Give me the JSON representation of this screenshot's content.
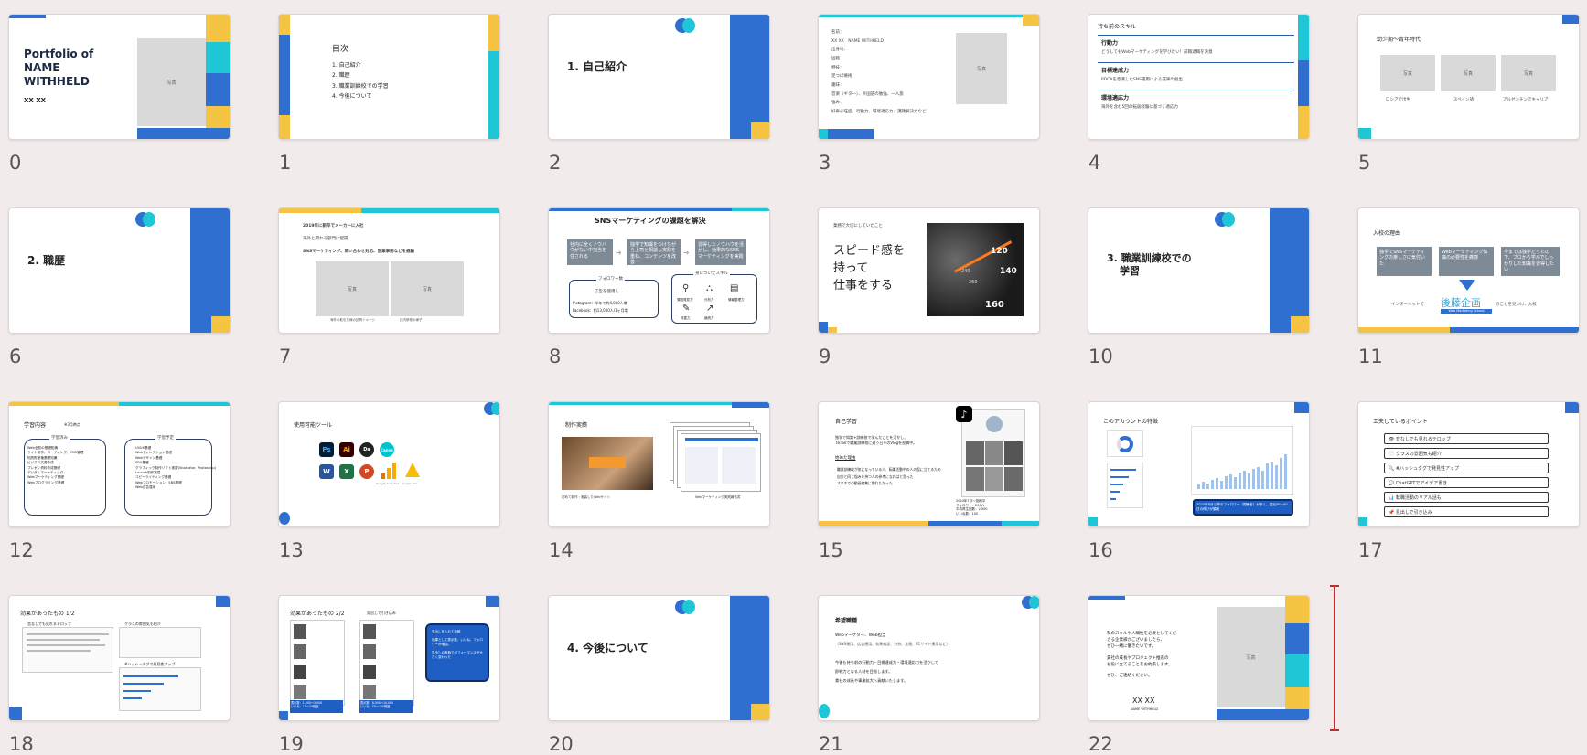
{
  "slides": [
    {
      "n": "0",
      "title": [
        "Portfolio of",
        "NAME",
        "WITHHELD"
      ],
      "sub": "XX XX",
      "photo": "写真"
    },
    {
      "n": "1",
      "title": "目次",
      "items": [
        "1. 自己紹介",
        "2. 職歴",
        "3. 職業訓練校での学習",
        "4. 今後について"
      ]
    },
    {
      "n": "2",
      "title": "1. 自己紹介"
    },
    {
      "n": "3",
      "rows": [
        "名前：",
        "XX XX　NAME WITHHELD",
        "出身地：",
        "国籍",
        "特技：",
        "足つぼ療術",
        "趣味：",
        "音楽（ギター）、外国語の勉強、一人旅",
        "強み：",
        "好奇心旺盛、行動力、環境適応力、課題解決力など"
      ],
      "photo": "写真"
    },
    {
      "n": "4",
      "title": "持ち前のスキル",
      "items": [
        {
          "h": "行動力",
          "d": "どうしてもWebマーケティングを学びたい！前職退職を決意"
        },
        {
          "h": "目標達成力",
          "d": "PDCAを意識したSNS運用による成果の創出"
        },
        {
          "h": "環境適応力",
          "d": "海外を含む5回の転居経験に基づく適応力"
        }
      ]
    },
    {
      "n": "5",
      "title": "幼少期〜青年時代",
      "photos": [
        "写真",
        "写真",
        "写真"
      ],
      "caps": [
        "ロシアで出生",
        "スペイン語",
        "アルゼンチンでキャリア"
      ]
    },
    {
      "n": "6",
      "title": "2. 職歴"
    },
    {
      "n": "7",
      "lines": [
        "2019年に新卒でメーカーに入社",
        "海外と関わる部門に配属",
        "SNSマーケティング、問い合わせ対応、営業事務などを経験"
      ],
      "photos": [
        "写真",
        "写真"
      ],
      "caps": [
        "海外の取引先様の訪問イメージ",
        "社内研修の様子"
      ]
    },
    {
      "n": "8",
      "title": "SNSマーケティングの課題を解決",
      "steps": [
        "社内に全くノウハウがない中担当を任される",
        "独学で知識をつけながら上司と相談し実践を重ね、コンテンツを改善",
        "習得したノウハウを活かし、効果的なSNSマーケティングを実践"
      ],
      "followers": "フォロワー数",
      "ad": "広告を使用し…",
      "ig": "Instagram：半年で約4,000人増",
      "fb": "Facebook：約13,000人/1ヶ月増",
      "skills": "身についたスキル",
      "skill_items": [
        "課題発見力",
        "分析力",
        "情報整理力",
        "改善力",
        "継続力"
      ]
    },
    {
      "n": "9",
      "cap": "業務で大切にしていたこと",
      "lines": [
        "スピード感を",
        "持って",
        "仕事をする"
      ],
      "gauge": [
        "120",
        "140",
        "160",
        "240",
        "260"
      ]
    },
    {
      "n": "10",
      "title": [
        "3. 職業訓練校での",
        "学習"
      ]
    },
    {
      "n": "11",
      "title": "入校の理由",
      "boxes": [
        "独学でSNSマーケティングの楽しさに気付いた",
        "Webマーケティング知識の必要性を痛感",
        "今までは独学だったので、プロから学んでしっかりした知識を習得したい"
      ],
      "left": "インターネットで",
      "logo": "後藤企画",
      "logo_sub": "Web Marketing School",
      "right": "のことを見つけ、入校"
    },
    {
      "n": "12",
      "title": "学習内容",
      "title_sub": "※3月時点",
      "col1": "学習済み",
      "col1_items": [
        "Web全般の基礎知識",
        "サイト制作、コーディング、CMS管理",
        "知的財産権基礎知識",
        "ビジネス文書作成",
        "プレゼン資料作成基礎",
        "デジタルマーケティング",
        "Webマーケティング基礎",
        "Webプログラミング基礎"
      ],
      "col2": "学習予定",
      "col2_items": [
        "UI/UX基礎",
        "Webディレクション基礎",
        "Webデザイン基礎",
        "SEO基礎",
        "グラフィック制作ソフト実習(Illustrator, Photoshop)",
        "Launch制作実習",
        "コピーライティング基礎",
        "Webプロモーション、SNS基礎",
        "Web広告運用"
      ]
    },
    {
      "n": "13",
      "title": "使用可能ツール",
      "tools": [
        "Ps",
        "Ai",
        "Da",
        "Canva",
        "W",
        "X",
        "P",
        "Google Analytics",
        "Google Ads"
      ]
    },
    {
      "n": "14",
      "title": "制作実績",
      "caps": [
        "初めて制作・実装したWebサイト",
        "Webマーケティング実践報告書"
      ]
    },
    {
      "n": "15",
      "title": "自己学習",
      "desc": [
        "独学で知識+訓練校で学んだことを活かし、",
        "TikTokで職業訓練校に通う日々のVlogを投稿中。"
      ],
      "reason_title": "始めた理由",
      "reasons": [
        "職業訓練校が気になっている人、転職活動中の人の役に立てるため",
        "自分と同じ悩みを持つ人の参考になればと思った",
        "スマホでの動画編集に慣れたかった"
      ],
      "stats": [
        "2024年7月〜投稿中",
        "フォロワー：200人",
        "平均再生回数：2,000",
        "いいね数：100"
      ]
    },
    {
      "n": "16",
      "title": "このアカウントの特徴",
      "note": "2024年8月以降のフォロワー（視聴者）が多く、直近30〜50日の伸びが顕著"
    },
    {
      "n": "17",
      "title": "工夫しているポイント",
      "items": [
        "👁 音なしでも見れるテロップ",
        "📄 クラスの雰囲気も紹介",
        "🔍 #ハッシュタグで発見性アップ",
        "💬 ChatGPTでアイデア書き",
        "📊 転職活動のリアル話も",
        "📌 見出しで引き込み"
      ]
    },
    {
      "n": "18",
      "title": "効果があったもの 1/2",
      "tags": [
        "音なしでも見れるテロップ",
        "クラスの雰囲気も紹介",
        "#ハッシュタグで発見性アップ"
      ]
    },
    {
      "n": "19",
      "title": "効果があったもの 2/2",
      "tag": "見出しで引き込み",
      "box": [
        "見出しを入れて投稿",
        "効果として表示数、いいね、フォロワーが増加。",
        "見出しの有無でパフォーマンスが大きく変わった"
      ],
      "s1": [
        "表示数：1,000〜3,000",
        "いいね：10〜20程度"
      ],
      "s2": [
        "表示数：8,000〜10,000",
        "いいね：50〜100程度"
      ]
    },
    {
      "n": "20",
      "title": "4. 今後について"
    },
    {
      "n": "21",
      "title": "希望職種",
      "lines": [
        "Webマーケター、Web担当",
        "（SNS運用、広告運用、効果検証、分析、企画、ECサイト運用など）",
        "今後も持ち前の行動力・目標達成力・環境適応力を活かして",
        "即戦力となる人材を目指します。",
        "貴社の成長や事業拡大へ貢献いたします。"
      ]
    },
    {
      "n": "22",
      "lines": [
        "私のスキルや人間性を必要としてくだ",
        "さる企業様がございましたら、",
        "ぜひ一緒に働きたいです。",
        "貴社の成長やプロジェクト推進の",
        "お役に立てることをお約束します。",
        "ぜひ、ご連絡ください。"
      ],
      "sig": "XX XX",
      "sig_sub": "NAME WITHHELD",
      "photo": "写真"
    }
  ],
  "colors": {
    "blue": "#2f6fd0",
    "yellow": "#f5c443",
    "teal": "#1ec6d6",
    "navy": "#1d3d74",
    "gray": "#7f8a97"
  }
}
